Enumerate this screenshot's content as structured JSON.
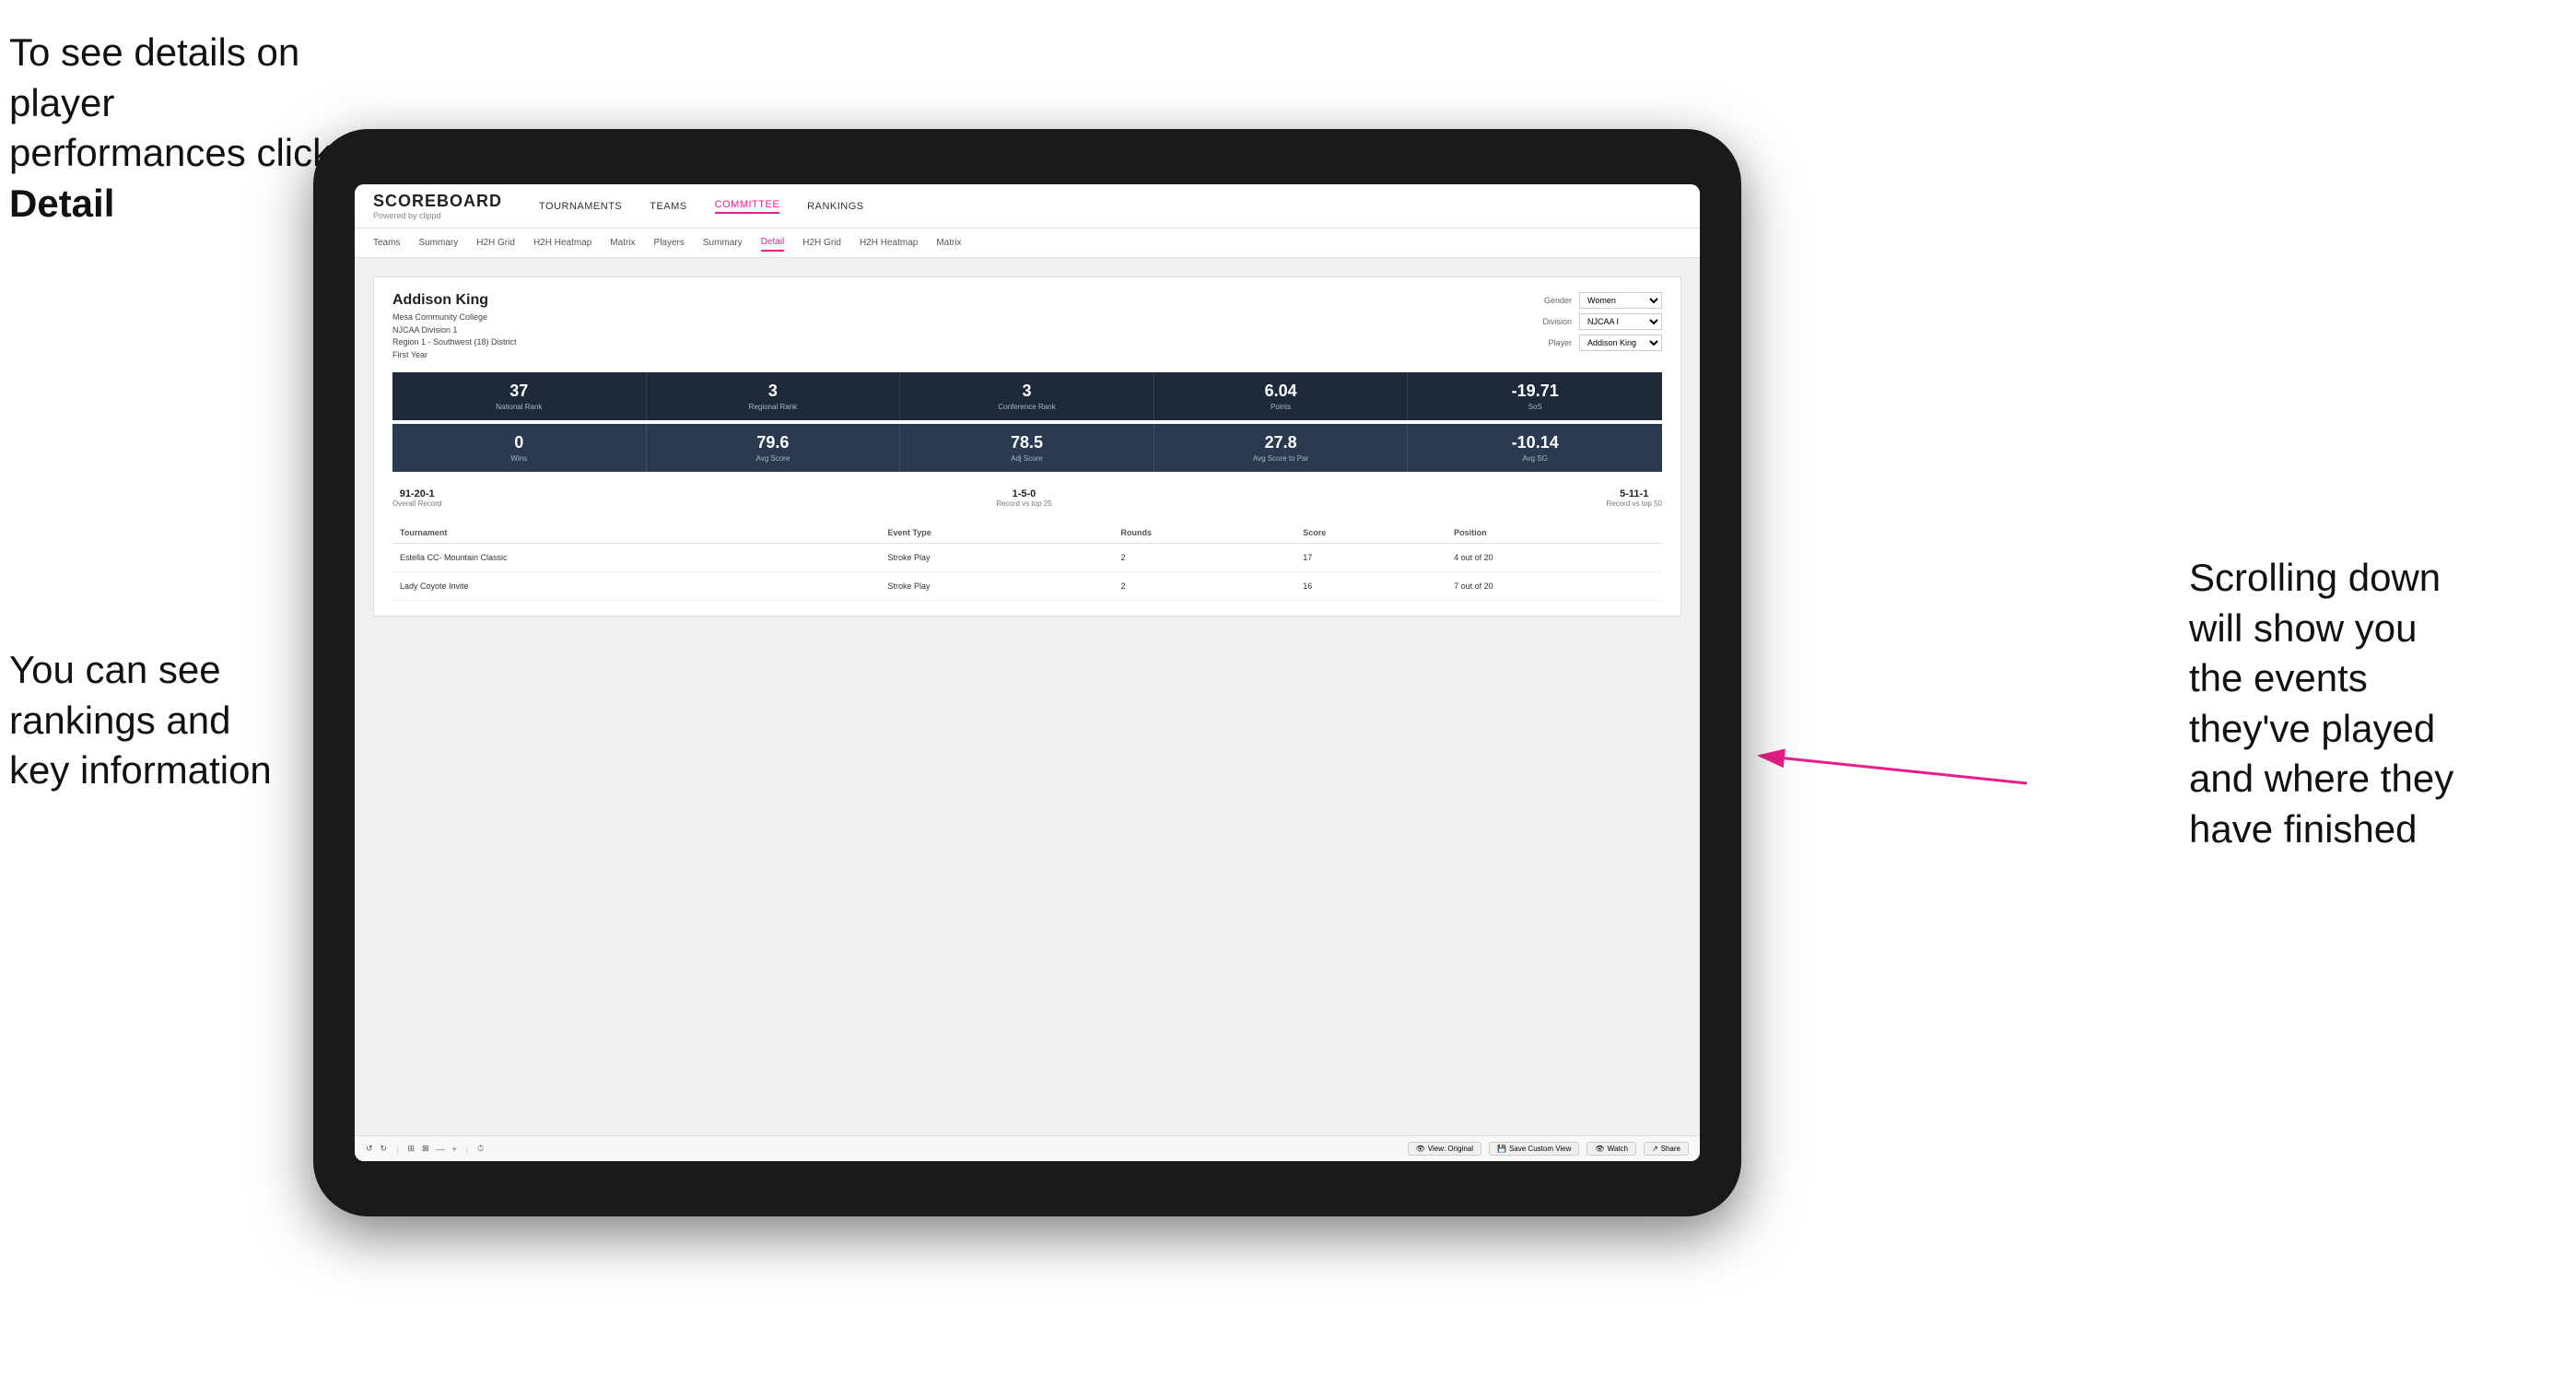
{
  "annotations": {
    "top_left": "To see details on player performances click",
    "top_left_bold": "Detail",
    "bottom_left_line1": "You can see",
    "bottom_left_line2": "rankings and",
    "bottom_left_line3": "key information",
    "right_line1": "Scrolling down",
    "right_line2": "will show you",
    "right_line3": "the events",
    "right_line4": "they've played",
    "right_line5": "and where they",
    "right_line6": "have finished"
  },
  "header": {
    "logo": "SCOREBOARD",
    "logo_sub": "Powered by clippd",
    "nav": [
      "TOURNAMENTS",
      "TEAMS",
      "COMMITTEE",
      "RANKINGS"
    ]
  },
  "subnav": {
    "tabs": [
      "Teams",
      "Summary",
      "H2H Grid",
      "H2H Heatmap",
      "Matrix",
      "Players",
      "Summary",
      "Detail",
      "H2H Grid",
      "H2H Heatmap",
      "Matrix"
    ],
    "active": "Detail"
  },
  "player": {
    "name": "Addison King",
    "college": "Mesa Community College",
    "division": "NJCAA Division 1",
    "region": "Region 1 - Southwest (18) District",
    "year": "First Year"
  },
  "filters": {
    "gender_label": "Gender",
    "gender_value": "Women",
    "division_label": "Division",
    "division_value": "NJCAA I",
    "player_label": "Player",
    "player_value": "Addison King"
  },
  "stats_row1": [
    {
      "value": "37",
      "label": "National Rank"
    },
    {
      "value": "3",
      "label": "Regional Rank"
    },
    {
      "value": "3",
      "label": "Conference Rank"
    },
    {
      "value": "6.04",
      "label": "Points"
    },
    {
      "value": "-19.71",
      "label": "SoS"
    }
  ],
  "stats_row2": [
    {
      "value": "0",
      "label": "Wins"
    },
    {
      "value": "79.6",
      "label": "Avg Score"
    },
    {
      "value": "78.5",
      "label": "Adj Score"
    },
    {
      "value": "27.8",
      "label": "Avg Score to Par"
    },
    {
      "value": "-10.14",
      "label": "Avg SG"
    }
  ],
  "records": [
    {
      "value": "91-20-1",
      "label": "Overall Record"
    },
    {
      "value": "1-5-0",
      "label": "Record vs top 25"
    },
    {
      "value": "5-11-1",
      "label": "Record vs top 50"
    }
  ],
  "table": {
    "headers": [
      "Tournament",
      "Event Type",
      "Rounds",
      "Score",
      "Position"
    ],
    "rows": [
      {
        "tournament": "Estella CC- Mountain Classic",
        "event_type": "Stroke Play",
        "rounds": "2",
        "score": "17",
        "position": "4 out of 20"
      },
      {
        "tournament": "Lady Coyote Invite",
        "event_type": "Stroke Play",
        "rounds": "2",
        "score": "16",
        "position": "7 out of 20"
      }
    ]
  },
  "toolbar": {
    "view_original": "View: Original",
    "save_custom": "Save Custom View",
    "watch": "Watch",
    "share": "Share"
  }
}
